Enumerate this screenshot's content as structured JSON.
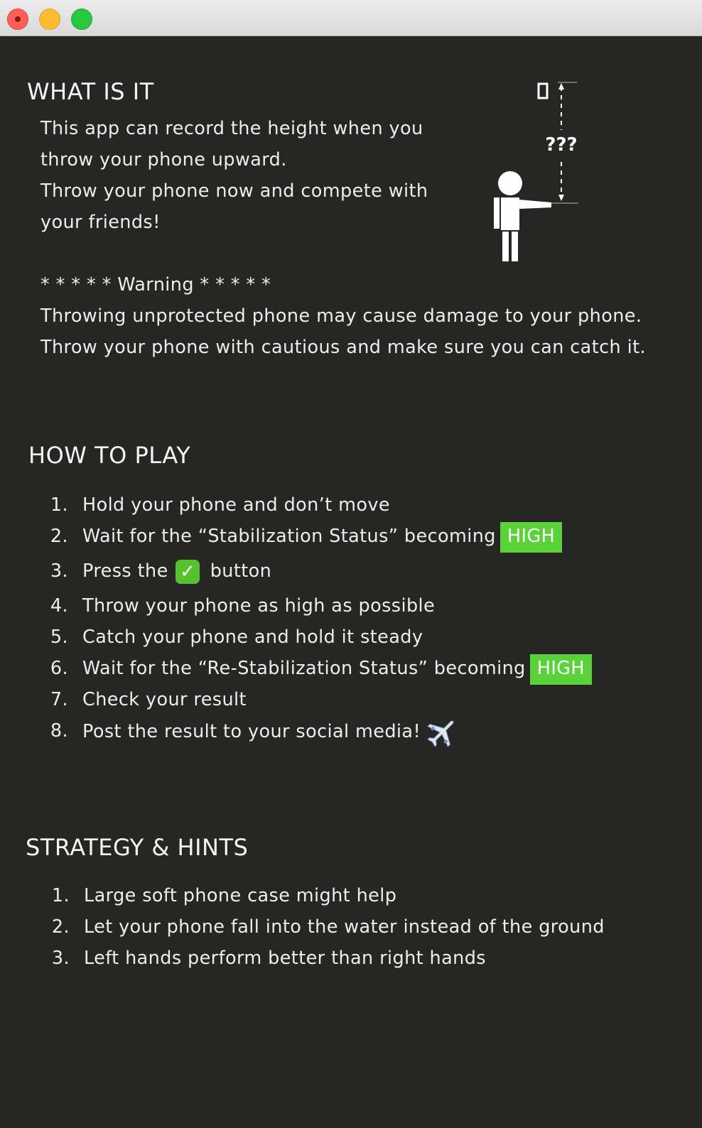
{
  "window": {
    "controls": [
      "close-button",
      "minimize-button",
      "zoom-button"
    ]
  },
  "what_is_it": {
    "heading": "WHAT IS IT",
    "lines": [
      "This app can record the height when you",
      "throw your phone upward.",
      "Throw your phone now and compete with",
      "your friends!"
    ],
    "warning_title": "* * * * * Warning * * * * *",
    "warning_lines": [
      "Throwing unprotected phone may cause damage to your phone.",
      "Throw your phone with cautious and make sure you can catch it."
    ],
    "illustration": {
      "top_label": "0",
      "height_label": "???"
    }
  },
  "how_to_play": {
    "heading": "HOW TO PLAY",
    "steps": [
      {
        "num": "1.",
        "text": "Hold your phone and don’t move"
      },
      {
        "num": "2.",
        "text": "Wait for the “Stabilization Status” becoming",
        "badge": "HIGH"
      },
      {
        "num": "3.",
        "text_before": "Press the",
        "text_after": "button",
        "icon": "check-icon"
      },
      {
        "num": "4.",
        "text": "Throw your phone as high as possible"
      },
      {
        "num": "5.",
        "text": "Catch your phone and hold it steady"
      },
      {
        "num": "6.",
        "text": "Wait for the “Re-Stabilization Status” becoming",
        "badge": "HIGH"
      },
      {
        "num": "7.",
        "text": "Check your result"
      },
      {
        "num": "8.",
        "text": "Post the result to your social media!",
        "icon": "airplane-icon"
      }
    ]
  },
  "strategy": {
    "heading": "STRATEGY & HINTS",
    "hints": [
      {
        "num": "1.",
        "text": "Large soft phone case might help"
      },
      {
        "num": "2.",
        "text": "Let your phone fall into the water instead of the ground"
      },
      {
        "num": "3.",
        "text": "Left hands perform better than right hands"
      }
    ]
  },
  "colors": {
    "background": "#262624",
    "badge_green": "#5ad33a",
    "text": "#ededed"
  }
}
